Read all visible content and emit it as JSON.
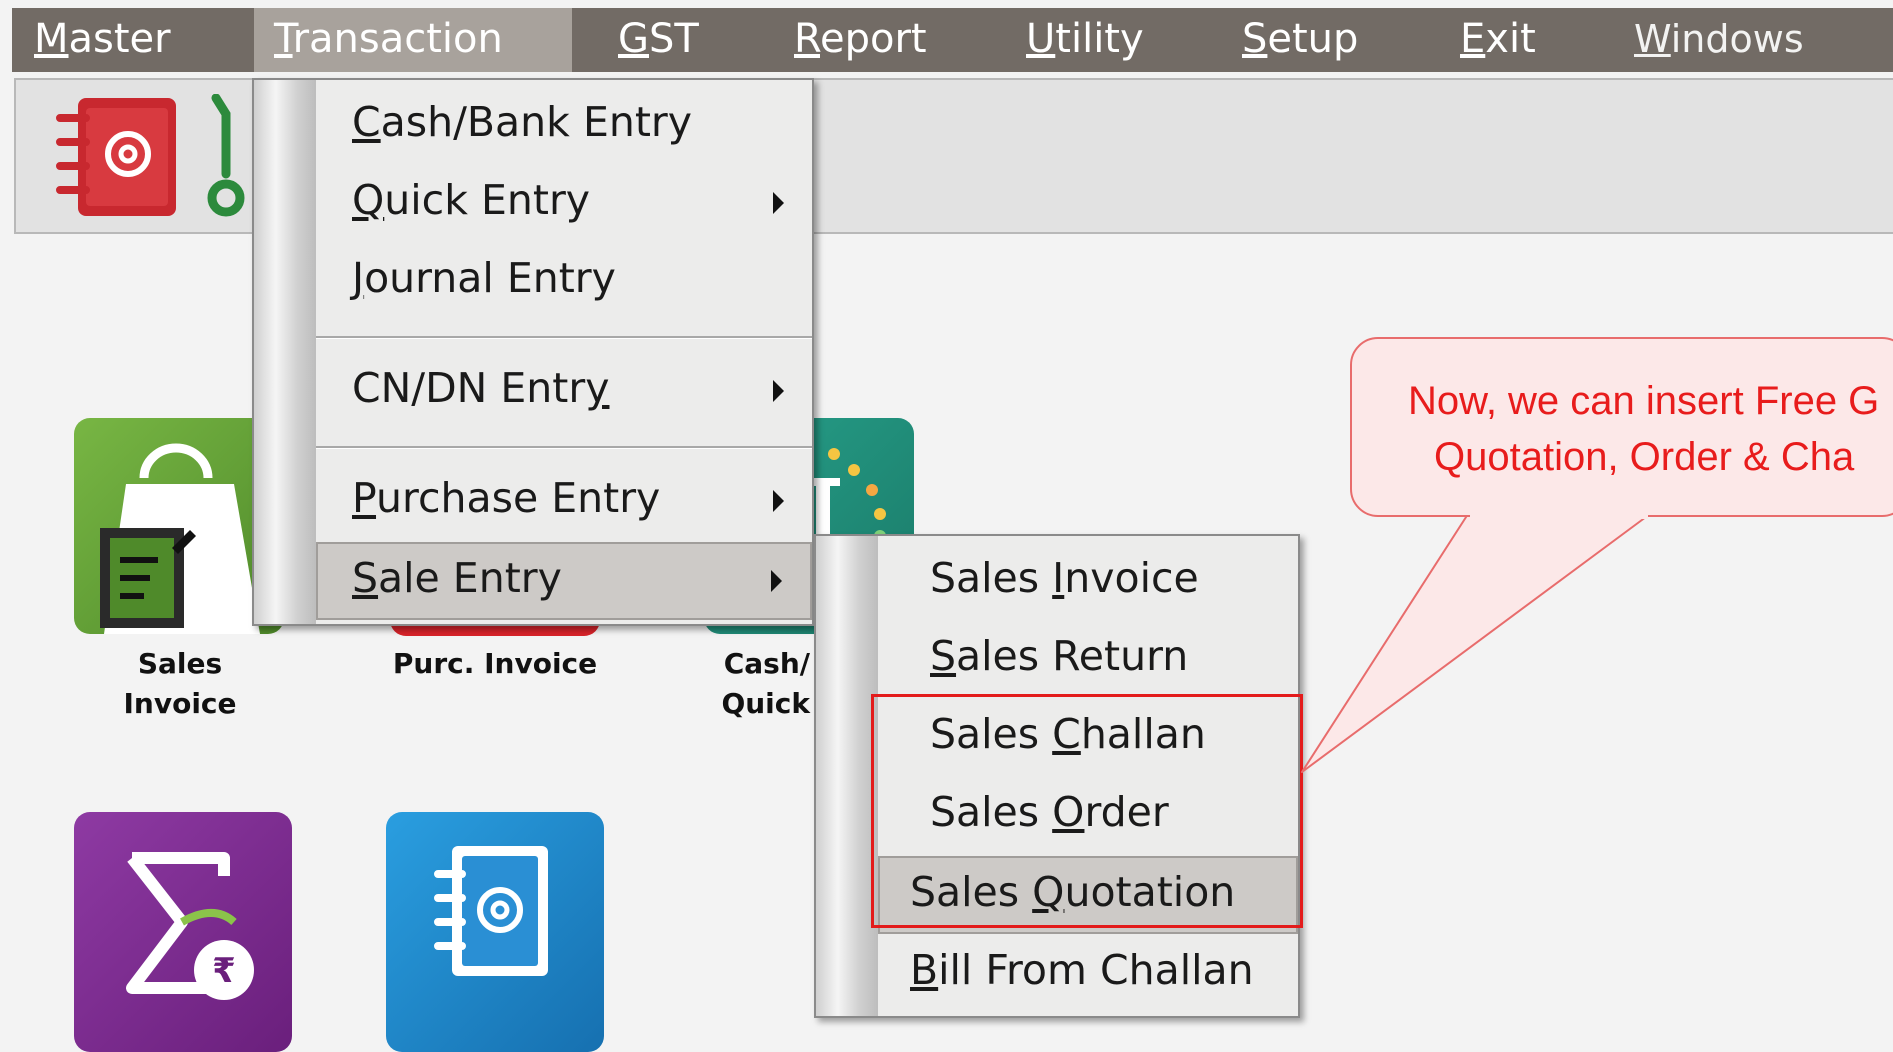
{
  "menubar": {
    "items": [
      {
        "pre": "",
        "ul": "M",
        "post": "aster"
      },
      {
        "pre": "",
        "ul": "T",
        "post": "ransaction"
      },
      {
        "pre": "",
        "ul": "G",
        "post": "ST"
      },
      {
        "pre": "",
        "ul": "R",
        "post": "eport"
      },
      {
        "pre": "",
        "ul": "U",
        "post": "tility"
      },
      {
        "pre": "",
        "ul": "S",
        "post": "etup"
      },
      {
        "pre": "",
        "ul": "E",
        "post": "xit"
      },
      {
        "pre": "",
        "ul": "W",
        "post": "indows"
      }
    ]
  },
  "desktop": {
    "tiles": [
      {
        "label_line1": "Sales",
        "label_line2": "Invoice",
        "icon": "shopping-bag-icon",
        "color": "#5e9b35"
      },
      {
        "label_line1": "Purc. Invoice",
        "label_line2": "",
        "icon": "purchase-icon",
        "color": "#d8232a"
      },
      {
        "label_line1": "Cash/",
        "label_line2": "Quick",
        "icon": "cash-quick-icon",
        "color": "#1e8c7a"
      },
      {
        "label_line1": "",
        "label_line2": "",
        "icon": "sigma-rupee-icon",
        "color": "#7b2a8c"
      },
      {
        "label_line1": "",
        "label_line2": "",
        "icon": "address-book-icon",
        "color": "#1a82c9"
      }
    ]
  },
  "transaction_menu": {
    "items": [
      {
        "pre": "",
        "ul": "C",
        "post": "ash/Bank Entry",
        "submenu": false
      },
      {
        "pre": "",
        "ul": "Q",
        "post": "uick Entry",
        "submenu": true
      },
      {
        "pre": "",
        "ul": "J",
        "post": "ournal Entry",
        "submenu": false
      },
      {
        "pre": "CN/DN Entr",
        "ul": "y",
        "post": "",
        "submenu": true
      },
      {
        "pre": "",
        "ul": "P",
        "post": "urchase Entry",
        "submenu": true
      },
      {
        "pre": "",
        "ul": "S",
        "post": "ale Entry",
        "submenu": true,
        "selected": true
      }
    ]
  },
  "sale_entry_menu": {
    "items": [
      {
        "pre": "Sales ",
        "ul": "I",
        "post": "nvoice"
      },
      {
        "pre": "",
        "ul": "S",
        "post": "ales Return"
      },
      {
        "pre": "Sales ",
        "ul": "C",
        "post": "hallan"
      },
      {
        "pre": "Sales ",
        "ul": "O",
        "post": "rder"
      },
      {
        "pre": "Sales ",
        "ul": "Q",
        "post": "uotation",
        "selected": true
      },
      {
        "pre": "",
        "ul": "B",
        "post": "ill From Challan"
      }
    ]
  },
  "callout": {
    "line1": "Now, we can insert Free G",
    "line2": "Quotation, Order & Cha"
  },
  "colors": {
    "menubar": "#726b65",
    "highlight": "#e31b1b",
    "callout_text": "#e81c1c",
    "callout_bg": "#fce8e8"
  }
}
